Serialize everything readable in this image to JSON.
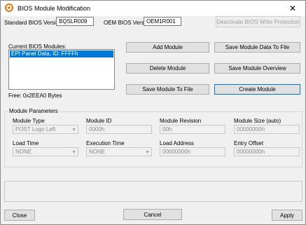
{
  "window": {
    "title": "BIOS Module Modification",
    "close_glyph": "✕"
  },
  "header": {
    "standard_bios_label": "Standard BIOS Version:",
    "standard_bios_value": "BQSLR009",
    "oem_bios_label": "OEM BIOS Version:",
    "oem_bios_value": "OEM1R001",
    "deactivate_button": "Deactivate BIOS Write Protection"
  },
  "modules": {
    "label": "Current BIOS Modules:",
    "items": [
      "EPI Panel Data, ID: FFFFh"
    ],
    "free_text": "Free: 0x2EEA0 Bytes"
  },
  "actions": {
    "add": "Add  Module",
    "save_data": "Save Module Data To File",
    "delete": "Delete Module",
    "overview": "Save Module Overview",
    "save_file": "Save Module To File",
    "create": "Create Module"
  },
  "params": {
    "legend": "Module Parameters",
    "module_type_label": "Module Type",
    "module_type_value": "POST Logo Left",
    "module_id_label": "Module ID",
    "module_id_value": "0000h",
    "module_revision_label": "Module Revision",
    "module_revision_value": "00h",
    "module_size_label": "Module Size (auto)",
    "module_size_value": "00000000h",
    "load_time_label": "Load Time",
    "load_time_value": "NONE",
    "execution_time_label": "Execution Time",
    "execution_time_value": "NONE",
    "load_address_label": "Load Address",
    "load_address_value": "00000000h",
    "entry_offset_label": "Entry Offset",
    "entry_offset_value": "00000000h"
  },
  "footer": {
    "close": "Close",
    "cancel": "Cancel",
    "apply": "Apply"
  },
  "colors": {
    "selection": "#0078d7",
    "window_bg": "#f0f0f0",
    "title_icon": "#e8720c"
  }
}
